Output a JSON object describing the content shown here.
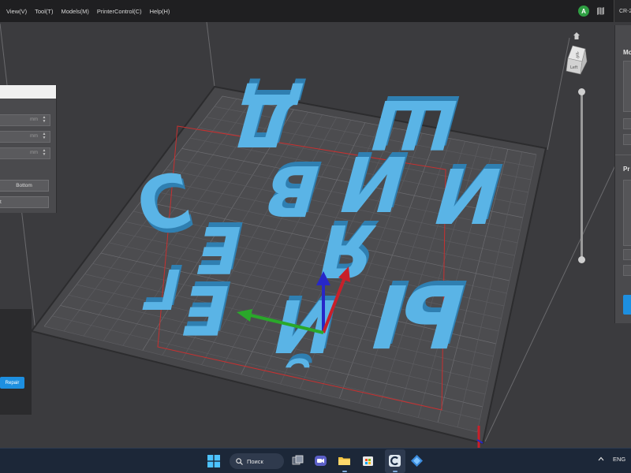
{
  "menubar": {
    "items": [
      {
        "label": "View(V)"
      },
      {
        "label": "Tool(T)"
      },
      {
        "label": "Models(M)"
      },
      {
        "label": "PrinterControl(C)"
      },
      {
        "label": "Help(H)"
      }
    ],
    "avatar_letter": "A",
    "avatar_color": "#2f9f43",
    "printer_name": "CR-2"
  },
  "left_dialog": {
    "units": [
      "mm",
      "mm",
      "mm"
    ],
    "bottom_button": "Bottom",
    "repair_button": "Repair"
  },
  "right_panel": {
    "section1_label": "Mo",
    "section2_label": "Pr"
  },
  "viewcube": {
    "top_face": "Top",
    "left_face": "Left"
  },
  "model": {
    "color": "#4fa9dc",
    "letters": [
      "Д",
      "Ш",
      "В",
      "И",
      "И",
      "С",
      "Е",
      "Я",
      "Е",
      "Ы",
      "Й",
      "Г"
    ]
  },
  "axes": {
    "x_color": "#c8202a",
    "y_color": "#2aa82a",
    "z_color": "#2727c8"
  },
  "taskbar": {
    "search_label": "Поиск",
    "language": "ENG",
    "icons": [
      "start-icon",
      "task-view-icon",
      "teams-icon",
      "file-explorer-icon",
      "store-icon",
      "creality-print-icon",
      "copilot-icon"
    ]
  }
}
